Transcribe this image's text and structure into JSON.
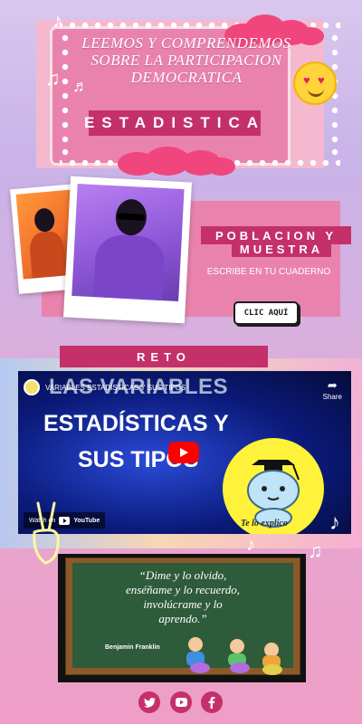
{
  "header": {
    "title_line1": "LEEMOS Y COMPRENDEMOS",
    "title_line2": "SOBRE LA PARTICIPACION",
    "title_line3": "DEMOCRATICA",
    "subject_label": "ESTADISTICA",
    "emoji_icon": "heart-eyes-icon"
  },
  "section": {
    "title_line1": "POBLACION Y",
    "title_line2": "MUESTRA",
    "instruction": "ESCRIBE EN TU CUADERNO",
    "button_label": "CLIC AQUÍ"
  },
  "reto": {
    "label": "RETO"
  },
  "video": {
    "title": "VARIABLES ESTADÍSTICAS Y SUS TIPOS",
    "share_label": "Share",
    "headline_line1": "LAS VARIABLES",
    "headline_line2": "ESTADÍSTICAS Y",
    "headline_line3": "SUS TIPOS",
    "caption": "Te lo explico",
    "watch_on": "Watch on",
    "platform": "YouTube"
  },
  "quote": {
    "line1": "“Dime y lo olvido,",
    "line2": "enséñame y lo recuerdo,",
    "line3": "involúcrame y lo",
    "line4": "aprendo.”",
    "author": "Benjamin Franklin"
  },
  "social": {
    "icons": [
      "twitter-icon",
      "youtube-icon",
      "facebook-icon"
    ]
  },
  "colors": {
    "accent": "#c4306a",
    "pink": "#e983ad",
    "video_bg": "#0b1a7a"
  }
}
